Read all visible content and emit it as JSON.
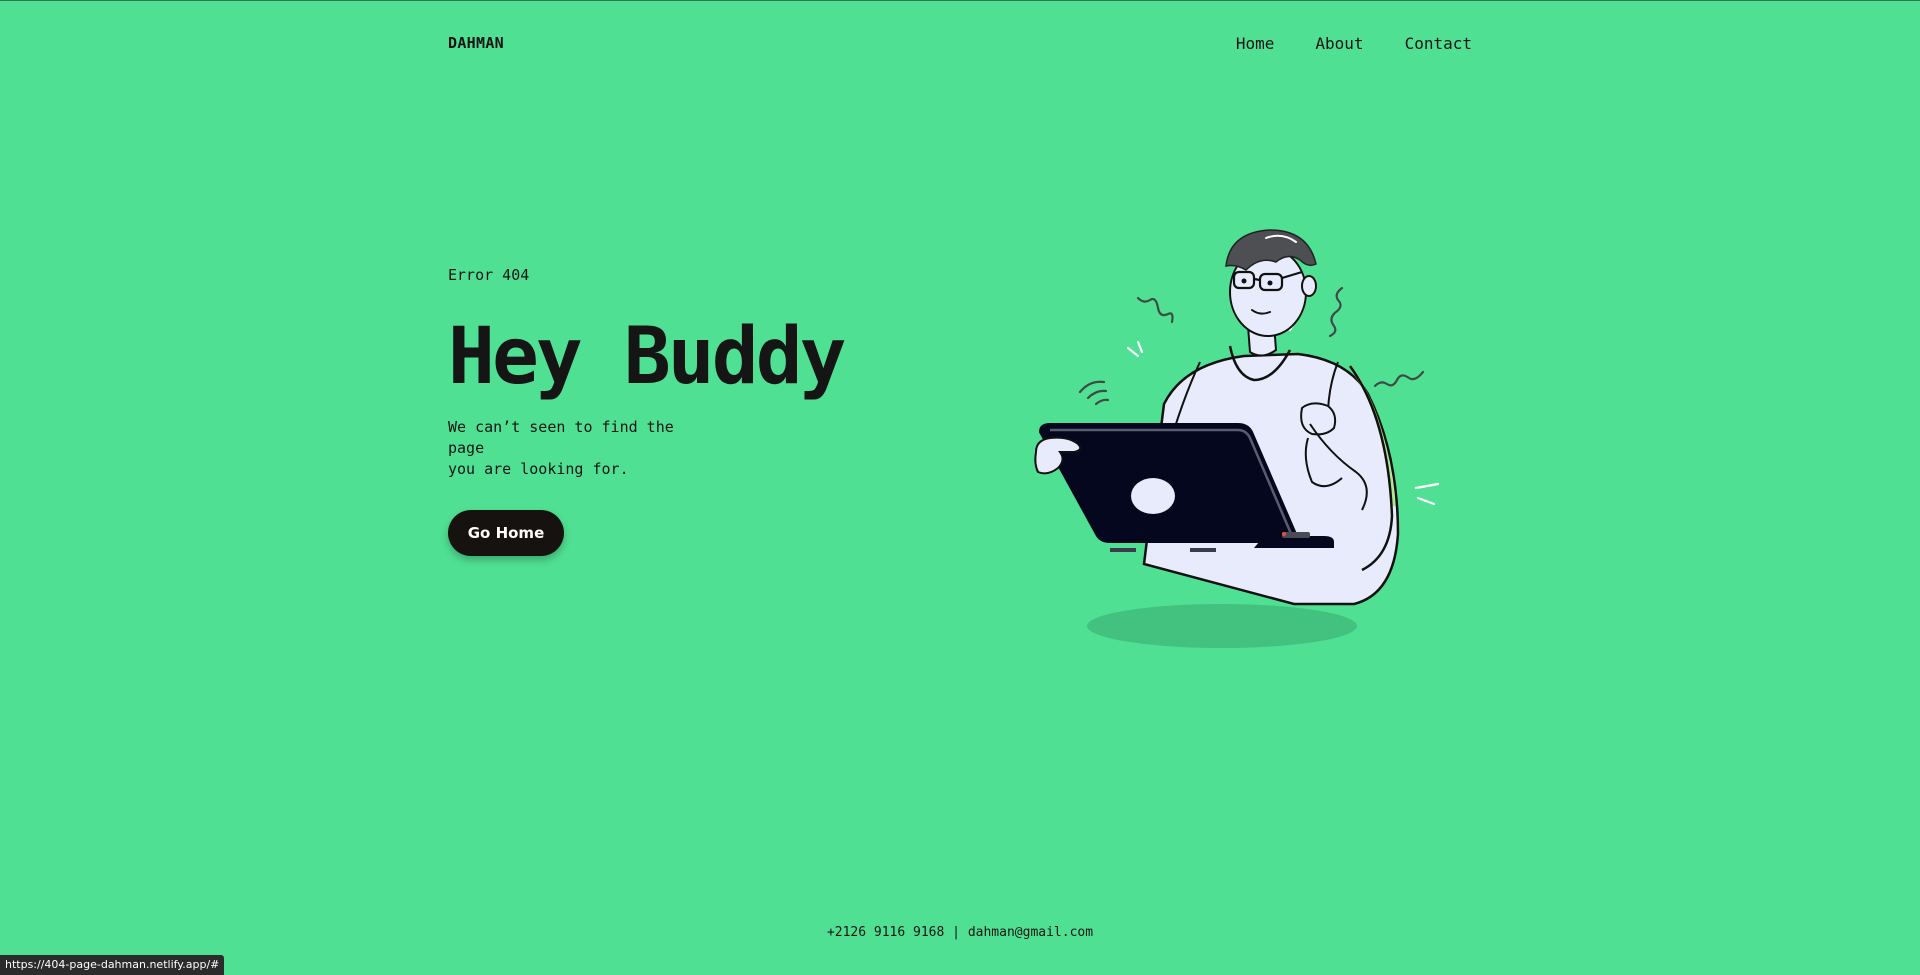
{
  "header": {
    "brand": "DAHMAN",
    "nav": [
      "Home",
      "About",
      "Contact"
    ]
  },
  "hero": {
    "eyebrow": "Error 404",
    "title": "Hey Buddy",
    "subtitle_line1": "We can’t seen to find the page",
    "subtitle_line2": "you are looking for.",
    "cta_label": "Go Home"
  },
  "footer": {
    "phone": "+2126 9116 9168",
    "separator": "|",
    "email": "dahman@gmail.com"
  },
  "status_bar": {
    "url": "https://404-page-dahman.netlify.app/#"
  },
  "theme": {
    "background": "#50e093",
    "text": "#151515",
    "button": "#16120f",
    "laptop": "#05071f",
    "shirt": "#e8ebfb",
    "hair": "#4d4f52"
  },
  "illustration": {
    "subject": "man-with-laptop",
    "icons": [
      "person-illustration",
      "laptop-icon",
      "shadow-ellipse"
    ]
  }
}
